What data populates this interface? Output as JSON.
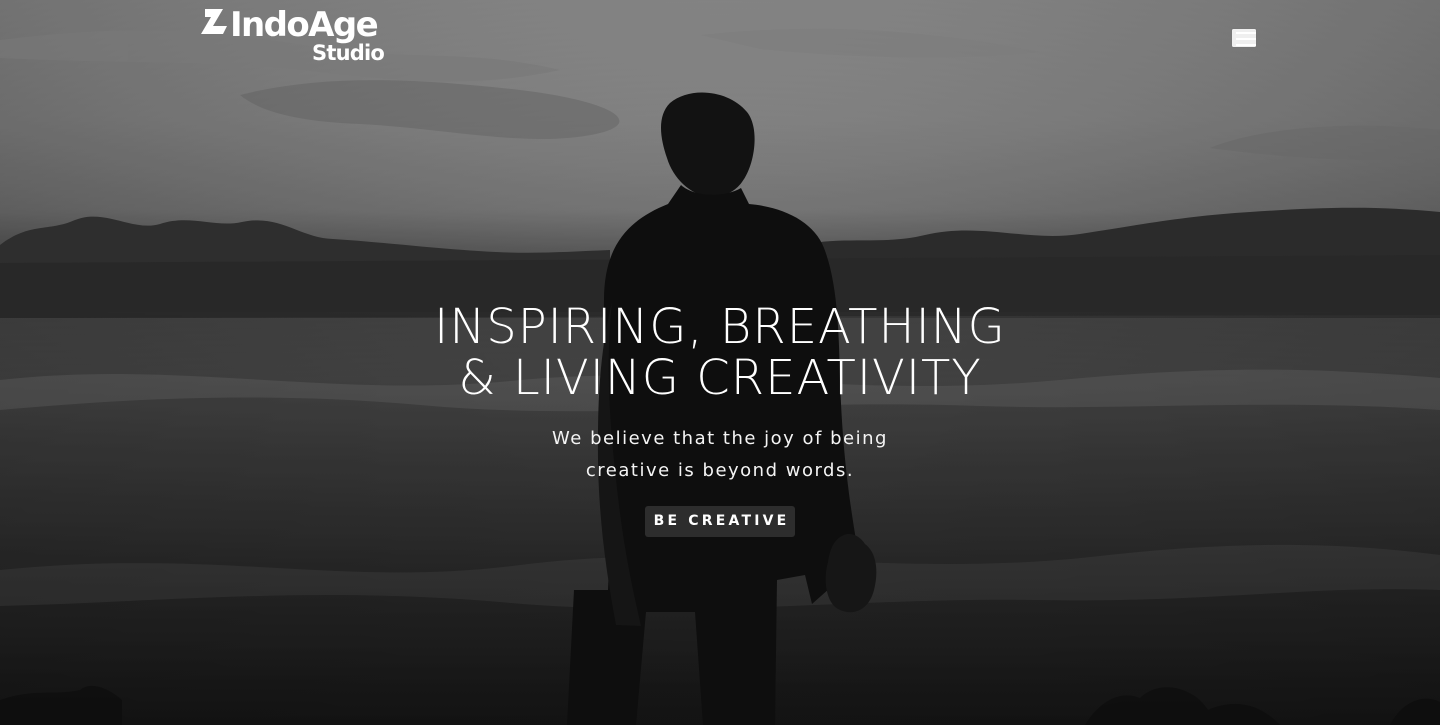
{
  "header": {
    "logo": {
      "primary_text": "IndoAge",
      "secondary_text": "Studio"
    },
    "menu_icon": "hamburger-menu-icon"
  },
  "hero": {
    "headline": {
      "line1": "INSPIRING, BREATHING",
      "line2": "& LIVING CREATIVITY"
    },
    "subtext": {
      "line1": "We believe that the joy of being",
      "line2": "creative is beyond words."
    },
    "cta": {
      "label": "BE CREATIVE"
    }
  },
  "colors": {
    "text": "#ffffff",
    "button_background": "#2d2d2d",
    "overlay_dark": "#1d1d1d"
  }
}
